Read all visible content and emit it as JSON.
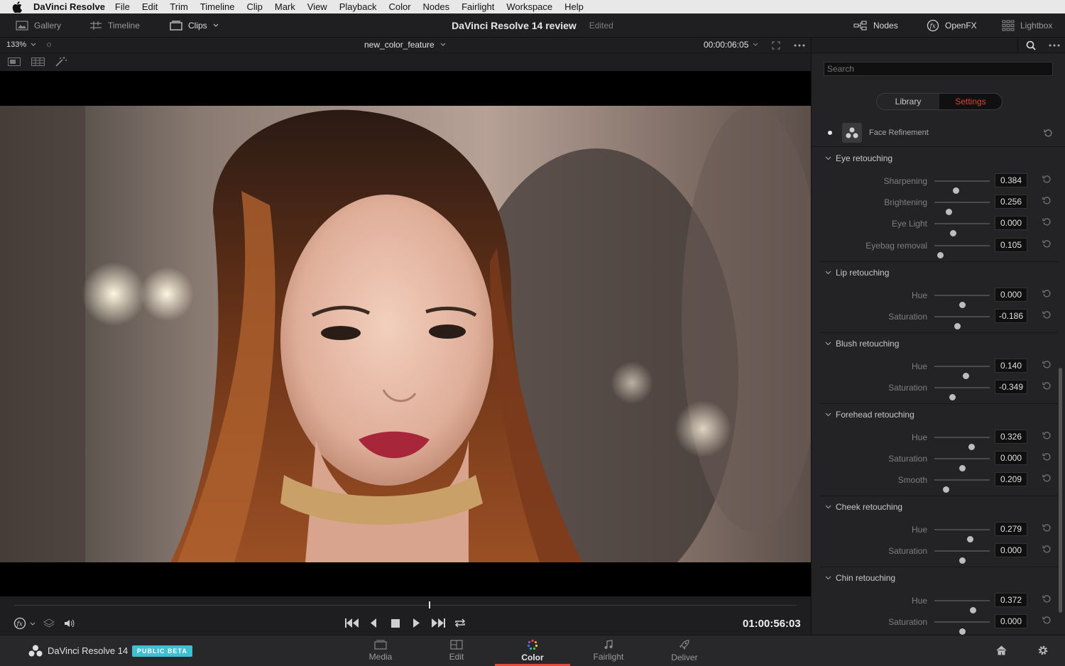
{
  "menubar": {
    "app_name": "DaVinci Resolve",
    "items": [
      "File",
      "Edit",
      "Trim",
      "Timeline",
      "Clip",
      "Mark",
      "View",
      "Playback",
      "Color",
      "Nodes",
      "Fairlight",
      "Workspace",
      "Help"
    ]
  },
  "toolbar": {
    "gallery": "Gallery",
    "timeline": "Timeline",
    "clips": "Clips",
    "project_title": "DaVinci Resolve 14 review",
    "status": "Edited",
    "nodes": "Nodes",
    "openfx": "OpenFX",
    "lightbox": "Lightbox"
  },
  "viewer": {
    "zoom": "133%",
    "clip_name": "new_color_feature",
    "clip_timecode": "00:00:06:05"
  },
  "transport": {
    "timecode": "01:00:56:03",
    "playhead_fraction": 0.53
  },
  "panel": {
    "search_placeholder": "Search",
    "tab_library": "Library",
    "tab_settings": "Settings",
    "plugin_name": "Face Refinement",
    "sections": [
      {
        "title": "Eye retouching",
        "params": [
          {
            "label": "Sharpening",
            "value": "0.384",
            "pos": 0.384
          },
          {
            "label": "Brightening",
            "value": "0.256",
            "pos": 0.256
          },
          {
            "label": "Eye Light",
            "value": "0.000",
            "pos": 0.333
          },
          {
            "label": "Eyebag removal",
            "value": "0.105",
            "pos": 0.105
          }
        ]
      },
      {
        "title": "Lip retouching",
        "params": [
          {
            "label": "Hue",
            "value": "0.000",
            "pos": 0.5
          },
          {
            "label": "Saturation",
            "value": "-0.186",
            "pos": 0.407
          }
        ]
      },
      {
        "title": "Blush retouching",
        "params": [
          {
            "label": "Hue",
            "value": "0.140",
            "pos": 0.57
          },
          {
            "label": "Saturation",
            "value": "-0.349",
            "pos": 0.325
          }
        ]
      },
      {
        "title": "Forehead retouching",
        "params": [
          {
            "label": "Hue",
            "value": "0.326",
            "pos": 0.663
          },
          {
            "label": "Saturation",
            "value": "0.000",
            "pos": 0.5
          },
          {
            "label": "Smooth",
            "value": "0.209",
            "pos": 0.209
          }
        ]
      },
      {
        "title": "Cheek retouching",
        "params": [
          {
            "label": "Hue",
            "value": "0.279",
            "pos": 0.64
          },
          {
            "label": "Saturation",
            "value": "0.000",
            "pos": 0.5
          }
        ]
      },
      {
        "title": "Chin retouching",
        "params": [
          {
            "label": "Hue",
            "value": "0.372",
            "pos": 0.686
          },
          {
            "label": "Saturation",
            "value": "0.000",
            "pos": 0.5
          }
        ]
      }
    ]
  },
  "bottom": {
    "app_label": "DaVinci Resolve 14",
    "badge": "PUBLIC BETA",
    "pages": [
      "Media",
      "Edit",
      "Color",
      "Fairlight",
      "Deliver"
    ],
    "active_page": "Color",
    "accent": "#e34b3c",
    "badge_color": "#3fbfd0"
  }
}
